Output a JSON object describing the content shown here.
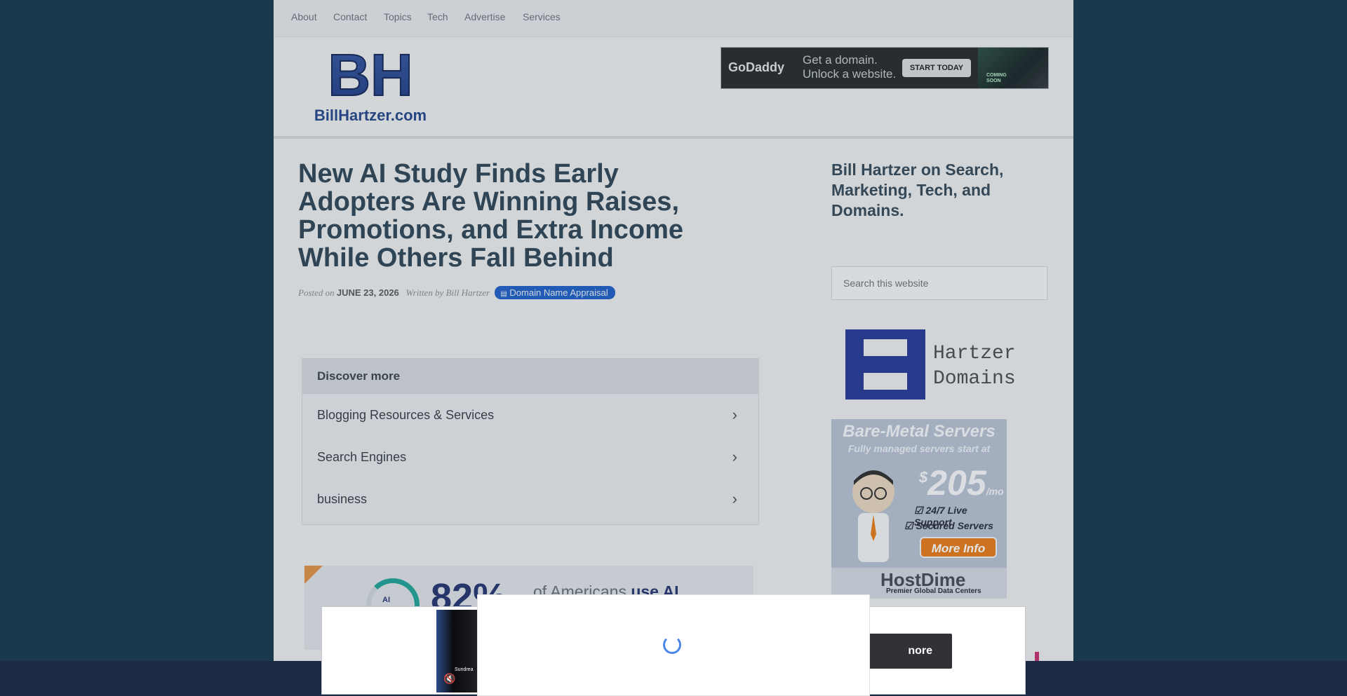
{
  "topnav": {
    "items": [
      "About",
      "Contact",
      "Topics",
      "Tech",
      "Advertise",
      "Services"
    ]
  },
  "header": {
    "logo_letters": "BH",
    "logo_text": "BillHartzer.com",
    "ad": {
      "brand": "GoDaddy",
      "line1": "Get a domain.",
      "line2": "Unlock a website.",
      "button": "START TODAY",
      "art_text": "COMING SOON"
    }
  },
  "post": {
    "title": "New AI Study Finds Early Adopters Are Winning Raises, Promotions, and Extra Income While Others Fall Behind",
    "posted_on_label": "Posted on",
    "date": "JUNE 23, 2026",
    "written_by_label": "Written by",
    "author": "Bill Hartzer",
    "category": "Domain Name Appraisal"
  },
  "discover": {
    "heading": "Discover more",
    "items": [
      "Blogging Resources & Services",
      "Search Engines",
      "business"
    ]
  },
  "infographic": {
    "percent": "82%",
    "text_before": "of Americans",
    "text_bold": "use AI",
    "chip_label": "AI"
  },
  "sidebar": {
    "title": "Bill Hartzer on Search, Marketing, Tech, and Domains.",
    "search_placeholder": "Search this website",
    "hartzer_domains_line1": "Hartzer",
    "hartzer_domains_line2": "Domains",
    "server_ad": {
      "title": "Bare-Metal Servers",
      "subtitle": "Fully managed servers start at",
      "currency": "$",
      "price": "205",
      "per": "/mo",
      "feature1": "24/7 Live Support",
      "feature2": "Secured Servers",
      "button": "More Info",
      "brand": "HostDime",
      "tagline": "Premier Global Data Centers"
    }
  },
  "sticky_ad": {
    "button": "nore",
    "thumb_caption": "Sundrea"
  },
  "colors": {
    "page_bg": "#1d3d52",
    "title": "#344b5c",
    "category_badge": "#2563c9",
    "spinner": "#4a86e8"
  }
}
